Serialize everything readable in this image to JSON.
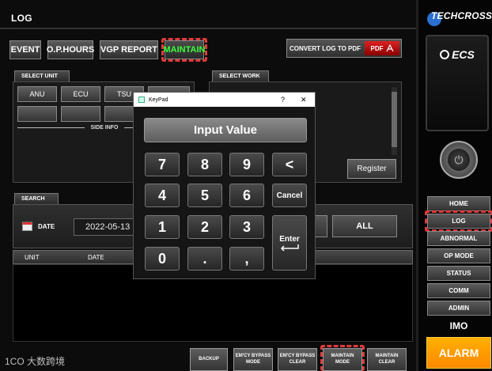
{
  "page": {
    "title": "LOG"
  },
  "tabs": [
    {
      "label": "EVENT"
    },
    {
      "label": "O.P.HOURS"
    },
    {
      "label": "VGP REPORT"
    },
    {
      "label": "MAINTAIN",
      "active": true
    }
  ],
  "convert_pdf": {
    "label": "CONVERT LOG TO PDF",
    "tag": "PDF"
  },
  "select_unit": {
    "title": "SELECT UNIT",
    "units": [
      "ANU",
      "ECU",
      "TSU",
      ""
    ],
    "side_info": "SIDE INFO"
  },
  "select_work": {
    "title": "SELECT WORK",
    "register_label": "Register"
  },
  "search": {
    "title": "SEARCH",
    "date_label": "DATE",
    "date_value": "2022-05-13",
    "all_label": "ALL"
  },
  "table": {
    "columns": [
      "UNIT",
      "DATE"
    ]
  },
  "bottom_buttons": [
    {
      "label": "BACKUP"
    },
    {
      "label": "EM'CY BYPASS MODE"
    },
    {
      "label": "EM'CY BYPASS CLEAR"
    },
    {
      "label": "MAINTAIN MODE",
      "highlighted": true
    },
    {
      "label": "MAINTAIN CLEAR"
    }
  ],
  "keypad": {
    "window_title": "KeyPad",
    "help_glyph": "?",
    "close_glyph": "✕",
    "display": "Input Value",
    "keys": {
      "k7": "7",
      "k8": "8",
      "k9": "9",
      "back": "<",
      "k4": "4",
      "k5": "5",
      "k6": "6",
      "cancel": "Cancel",
      "k1": "1",
      "k2": "2",
      "k3": "3",
      "enter": "Enter",
      "k0": "0",
      "dot": ".",
      "comma": ","
    }
  },
  "brand": {
    "name": "TECHCROSS",
    "product": "ECS"
  },
  "nav": [
    {
      "label": "HOME"
    },
    {
      "label": "LOG",
      "active": true
    },
    {
      "label": "ABNORMAL"
    },
    {
      "label": "OP MODE"
    },
    {
      "label": "STATUS"
    },
    {
      "label": "COMM"
    },
    {
      "label": "ADMIN"
    }
  ],
  "imo_label": "IMO",
  "alarm_label": "ALARM",
  "watermark": "大数跨境",
  "colors": {
    "highlight": "#e03a3a",
    "active_text": "#3bff3b",
    "alarm": "#ff9a00"
  }
}
